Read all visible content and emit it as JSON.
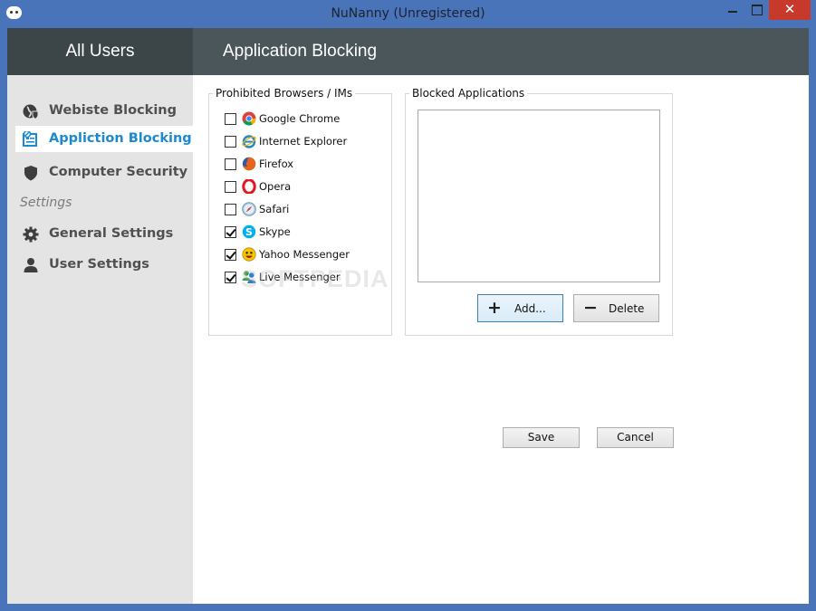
{
  "window": {
    "title": "NuNanny  (Unregistered)",
    "close_glyph": "✕",
    "accent_color": "#4a74b9"
  },
  "header": {
    "left_title": "All Users",
    "right_title": "Application Blocking"
  },
  "sidebar": {
    "items": [
      {
        "label": "Webiste Blocking",
        "icon": "globe-shield-icon",
        "active": false
      },
      {
        "label": "Appliction Blocking",
        "icon": "app-block-icon",
        "active": true
      },
      {
        "label": "Computer Security",
        "icon": "shield-icon",
        "active": false
      },
      {
        "label": "General Settings",
        "icon": "gear-icon",
        "active": false
      },
      {
        "label": "User Settings",
        "icon": "user-icon",
        "active": false
      }
    ],
    "section_label": "Settings"
  },
  "browsers_group": {
    "title": "Prohibited Browsers / IMs",
    "items": [
      {
        "label": "Google Chrome",
        "checked": false,
        "icon": "chrome-icon"
      },
      {
        "label": "Internet Explorer",
        "checked": false,
        "icon": "ie-icon"
      },
      {
        "label": "Firefox",
        "checked": false,
        "icon": "firefox-icon"
      },
      {
        "label": "Opera",
        "checked": false,
        "icon": "opera-icon"
      },
      {
        "label": "Safari",
        "checked": false,
        "icon": "safari-icon"
      },
      {
        "label": "Skype",
        "checked": true,
        "icon": "skype-icon"
      },
      {
        "label": "Yahoo Messenger",
        "checked": true,
        "icon": "yahoo-messenger-icon"
      },
      {
        "label": "Live Messenger",
        "checked": true,
        "icon": "live-messenger-icon"
      }
    ]
  },
  "apps_group": {
    "title": "Blocked Applications",
    "add_label": "Add...",
    "add_glyph": "+",
    "delete_label": "Delete",
    "delete_glyph": "−"
  },
  "footer": {
    "save_label": "Save",
    "cancel_label": "Cancel"
  },
  "watermark": "SOFTPEDIA"
}
